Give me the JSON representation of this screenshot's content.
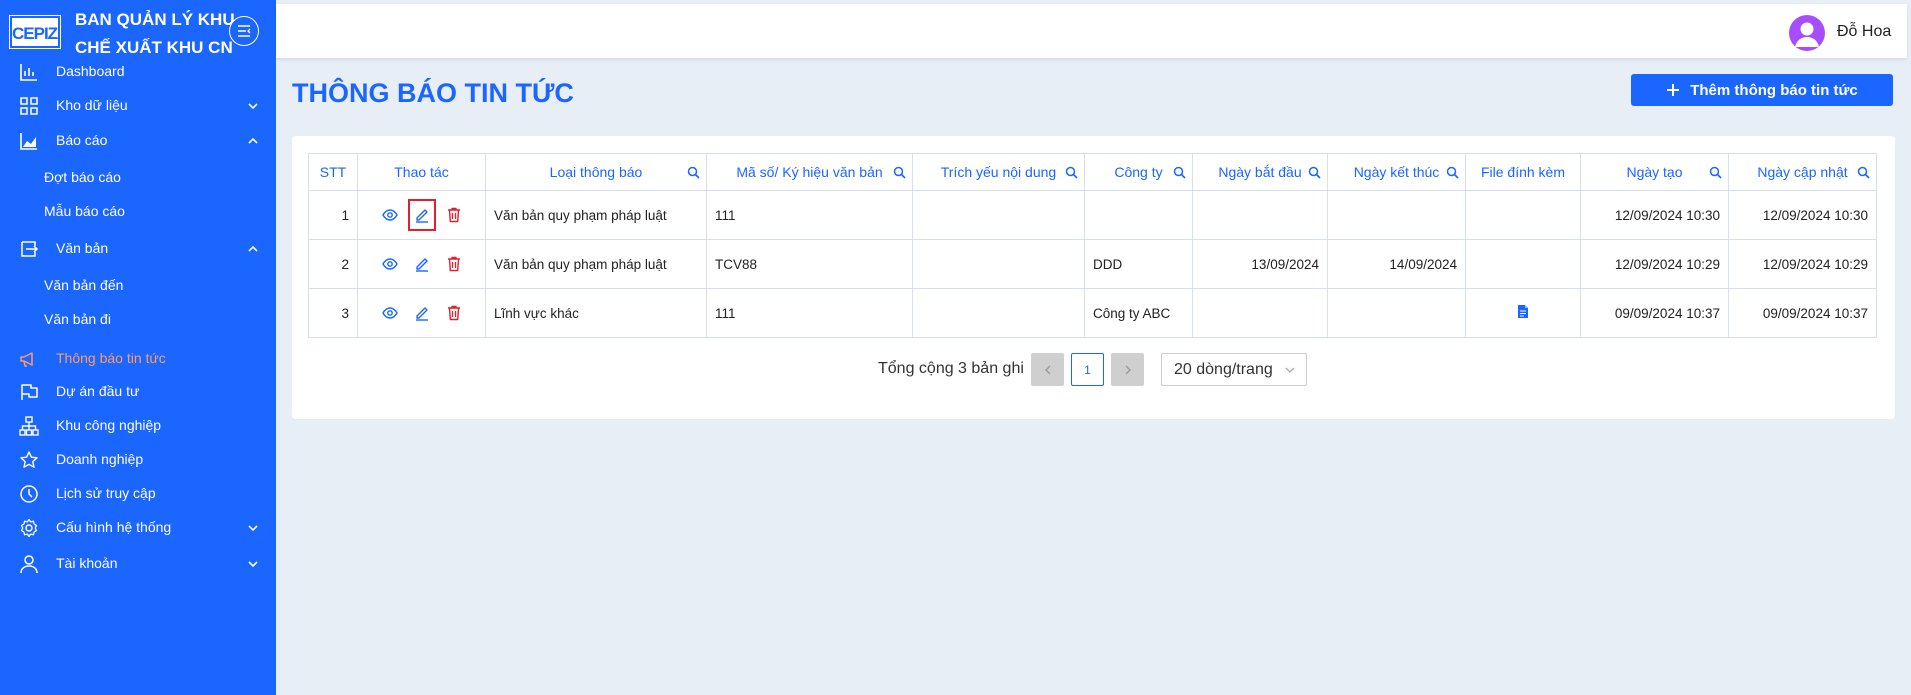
{
  "brand": {
    "logo_text": "CEPIZA",
    "title": "BAN QUẢN LÝ KHU\nCHẾ XUẤT KHU CN"
  },
  "colors": {
    "primary": "#1a66ff",
    "active_nav": "#ff9a6b",
    "delete": "#e0202a",
    "avatar": "#a64dff"
  },
  "sidebar": {
    "items": [
      {
        "label": "Dashboard",
        "icon": "bar-chart-icon"
      },
      {
        "label": "Kho dữ liệu",
        "icon": "grid-icon",
        "chevron": "down"
      },
      {
        "label": "Báo cáo",
        "icon": "area-chart-icon",
        "chevron": "up"
      },
      {
        "label": "Đợt báo cáo"
      },
      {
        "label": "Mẫu báo cáo"
      },
      {
        "label": "Văn bản",
        "icon": "document-transfer-icon",
        "chevron": "up"
      },
      {
        "label": "Văn bản đến"
      },
      {
        "label": "Văn bản đi"
      },
      {
        "label": "Thông báo tin tức",
        "icon": "megaphone-icon",
        "active": true
      },
      {
        "label": "Dự án đầu tư",
        "icon": "flag-icon"
      },
      {
        "label": "Khu công nghiệp",
        "icon": "hierarchy-icon"
      },
      {
        "label": "Doanh nghiệp",
        "icon": "star-icon"
      },
      {
        "label": "Lịch sử truy cập",
        "icon": "clock-icon"
      },
      {
        "label": "Cấu hình hệ thống",
        "icon": "gear-icon",
        "chevron": "down"
      },
      {
        "label": "Tài khoản",
        "icon": "user-icon",
        "chevron": "down"
      }
    ]
  },
  "header": {
    "user_name": "Đỗ Hoa"
  },
  "page": {
    "title": "THÔNG BÁO TIN TỨC",
    "add_button": "Thêm thông báo tin tức"
  },
  "table": {
    "columns": [
      "STT",
      "Thao tác",
      "Loại thông báo",
      "Mã số/ Ký hiệu văn bản",
      "Trích yếu nội dung",
      "Công ty",
      "Ngày bắt đầu",
      "Ngày kết thúc",
      "File đính kèm",
      "Ngày tạo",
      "Ngày cập nhật"
    ],
    "rows": [
      {
        "stt": "1",
        "type": "Văn bản quy phạm pháp luật",
        "code": "111",
        "summary": "",
        "company": "",
        "start": "",
        "end": "",
        "file": false,
        "created": "12/09/2024 10:30",
        "updated": "12/09/2024 10:30"
      },
      {
        "stt": "2",
        "type": "Văn bản quy phạm pháp luật",
        "code": "TCV88",
        "summary": "",
        "company": "DDD",
        "start": "13/09/2024",
        "end": "14/09/2024",
        "file": false,
        "created": "12/09/2024 10:29",
        "updated": "12/09/2024 10:29"
      },
      {
        "stt": "3",
        "type": "Lĩnh vực khác",
        "code": "111",
        "summary": "",
        "company": "Công ty ABC",
        "start": "",
        "end": "",
        "file": true,
        "created": "09/09/2024 10:37",
        "updated": "09/09/2024 10:37"
      }
    ]
  },
  "pagination": {
    "total_text": "Tổng cộng 3 bản ghi",
    "current_page": "1",
    "page_size": "20 dòng/trang"
  }
}
